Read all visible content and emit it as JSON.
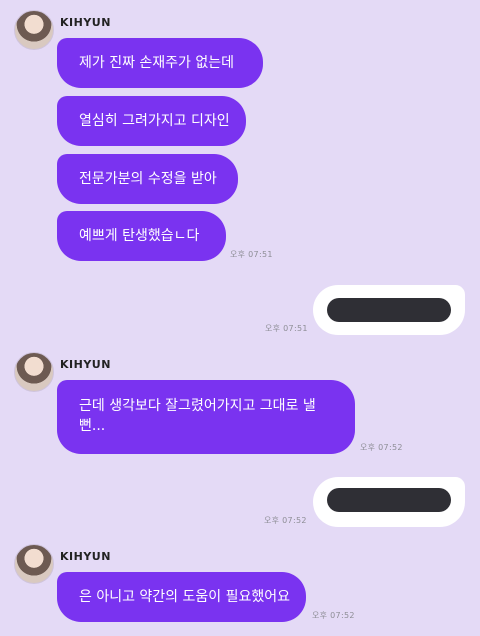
{
  "messages": [
    {
      "sender": "KIHYUN",
      "bubbles": [
        "제가 진짜 손재주가 없는데",
        "열심히 그려가지고 디자인",
        "전문가분의 수정을 받아",
        "예쁘게 탄생했습ㄴ다"
      ],
      "time": "오후 07:51"
    },
    {
      "sender": "me",
      "content": "[redacted]",
      "time": "오후 07:51"
    },
    {
      "sender": "KIHYUN",
      "bubbles": [
        "근데 생각보다 잘그렸어가지고 그대로 낼뻔..."
      ],
      "time": "오후 07:52"
    },
    {
      "sender": "me",
      "content": "[redacted]",
      "time": "오후 07:52"
    },
    {
      "sender": "KIHYUN",
      "bubbles": [
        "은 아니고 약간의 도움이 필요했어요"
      ],
      "time": "오후 07:52"
    }
  ],
  "colors": {
    "background": "#e4daf6",
    "incoming_bubble": "#7a33f0",
    "outgoing_bubble": "#ffffff",
    "redaction": "#2f2f35"
  }
}
